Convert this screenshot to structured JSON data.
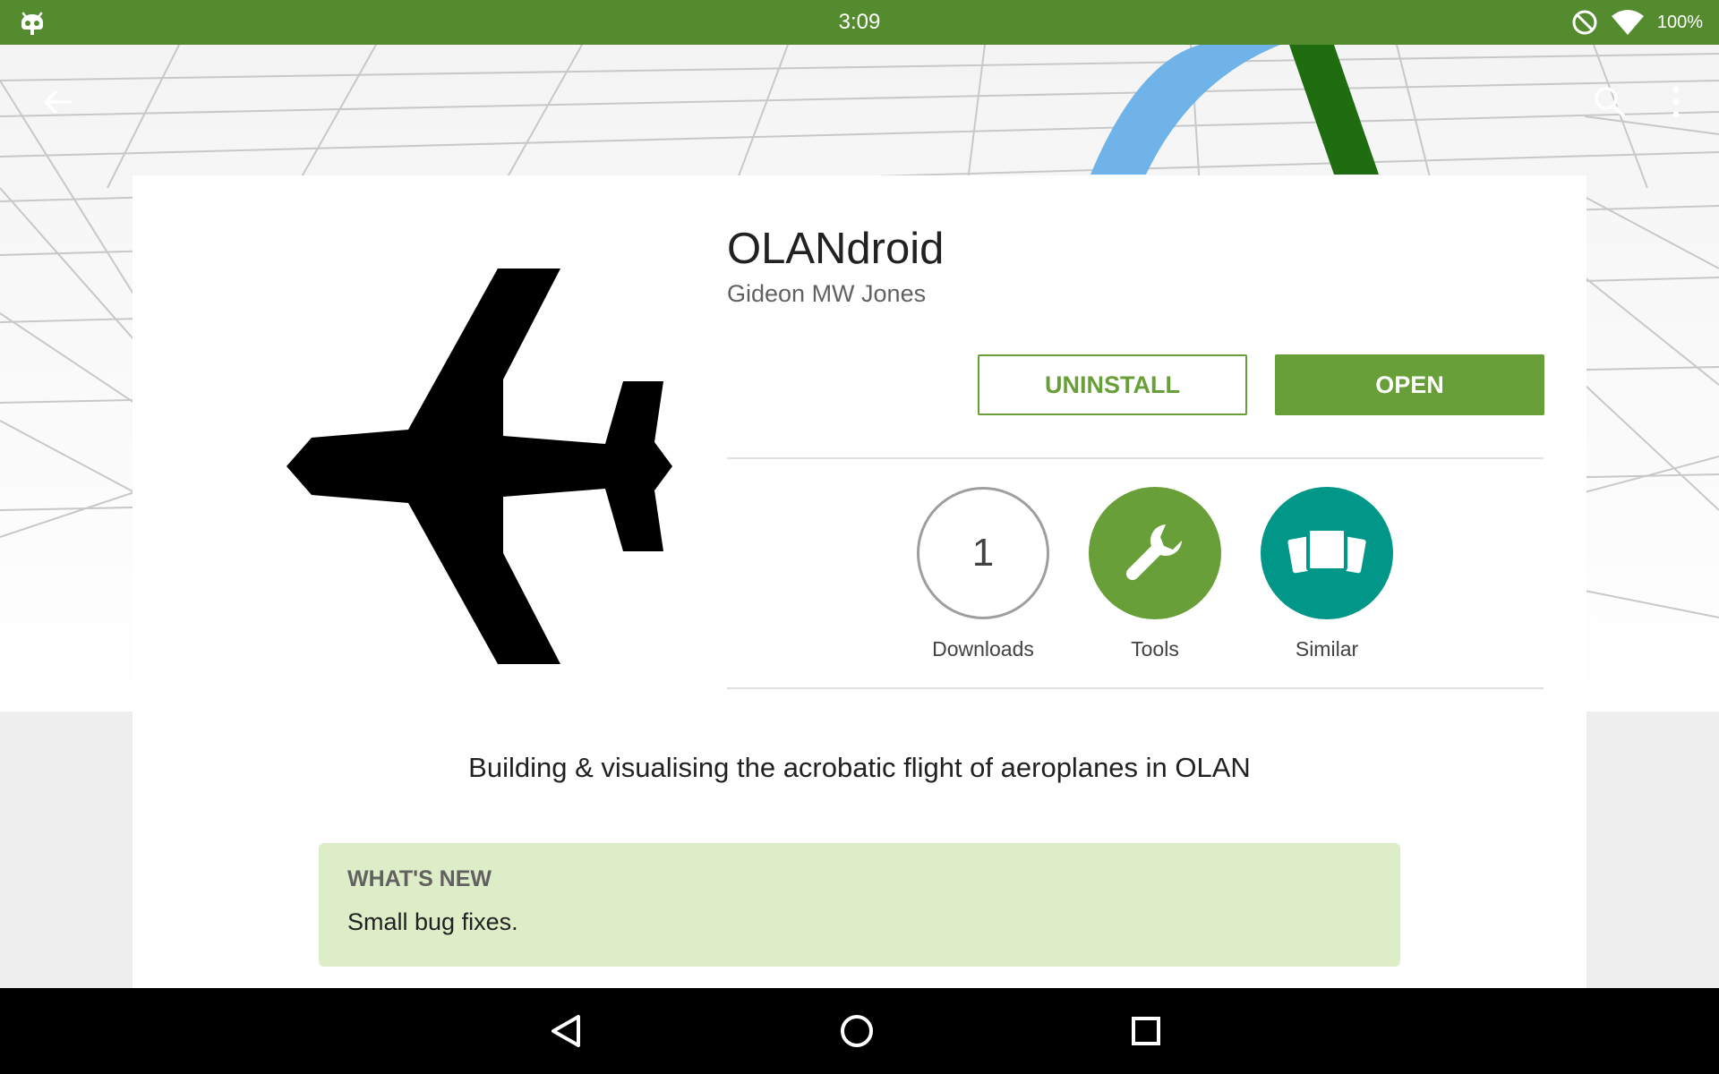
{
  "status_bar": {
    "time": "3:09",
    "battery": "100%",
    "left_icon": "cyanogen-bugdroid-icon",
    "icons": [
      "do-not-disturb-icon",
      "wifi-icon"
    ]
  },
  "action_bar": {
    "back_icon": "arrow-back-icon",
    "search_icon": "search-icon",
    "overflow_icon": "more-vert-icon"
  },
  "app": {
    "title": "OLANdroid",
    "developer": "Gideon MW Jones",
    "icon": "airplane-icon"
  },
  "buttons": {
    "uninstall": "UNINSTALL",
    "open": "OPEN"
  },
  "badges": [
    {
      "value": "1",
      "label": "Downloads"
    },
    {
      "icon": "wrench-icon",
      "label": "Tools"
    },
    {
      "icon": "cards-icon",
      "label": "Similar"
    }
  ],
  "description": "Building & visualising the acrobatic flight of aeroplanes in OLAN",
  "whats_new": {
    "title": "WHAT'S NEW",
    "text": "Small bug fixes."
  },
  "nav_bar": {
    "back": "nav-back-icon",
    "home": "nav-home-icon",
    "recents": "nav-recents-icon"
  },
  "colors": {
    "status_bar": "#558b2f",
    "accent": "#689f38",
    "similar": "#009688",
    "whats_new_bg": "#dcedc8"
  }
}
